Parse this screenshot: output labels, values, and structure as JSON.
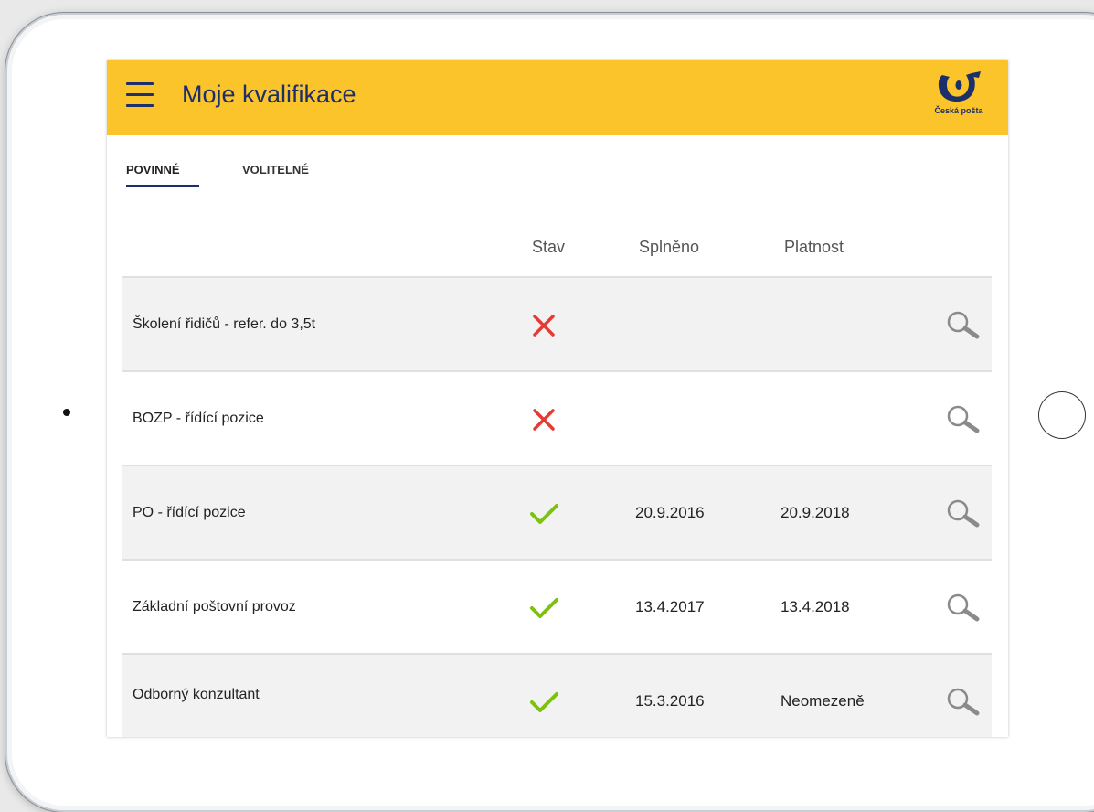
{
  "app_bar": {
    "title": "Moje kvalifikace",
    "logo_text": "Česká pošta",
    "menu_icon": "hamburger-icon",
    "accent_color": "#fbc42a",
    "brand_color": "#1c2f6a"
  },
  "tabs": [
    {
      "label": "POVINNÉ",
      "active": true
    },
    {
      "label": "VOLITELNÉ",
      "active": false
    }
  ],
  "table": {
    "columns": [
      "",
      "Stav",
      "Splněno",
      "Platnost",
      ""
    ],
    "rows": [
      {
        "name": "Školení řidičů - refer. do 3,5t",
        "status": "failed",
        "completed": "",
        "validity": "",
        "action_icon": "search-icon"
      },
      {
        "name": "BOZP - řídící pozice",
        "status": "failed",
        "completed": "",
        "validity": "",
        "action_icon": "search-icon"
      },
      {
        "name": "PO - řídící pozice",
        "status": "passed",
        "completed": "20.9.2016",
        "validity": "20.9.2018",
        "action_icon": "search-icon"
      },
      {
        "name": "Základní poštovní provoz",
        "status": "passed",
        "completed": "13.4.2017",
        "validity": "13.4.2018",
        "action_icon": "search-icon"
      },
      {
        "name": "Odborný konzultant",
        "status": "passed",
        "completed": "15.3.2016",
        "validity": "Neomezeně",
        "action_icon": "search-icon"
      }
    ]
  },
  "status_colors": {
    "failed": "#e53935",
    "passed": "#7cc20f"
  }
}
